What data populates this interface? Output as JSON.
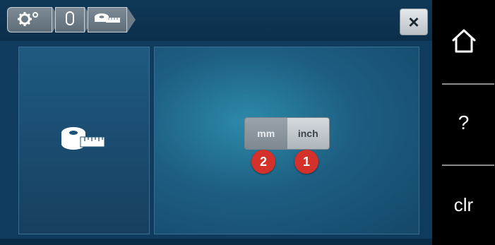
{
  "breadcrumb": {
    "items": [
      {
        "icon": "settings-gears-icon"
      },
      {
        "icon": "presser-foot-icon"
      },
      {
        "icon": "measuring-tape-icon"
      }
    ]
  },
  "close_label": "×",
  "units": {
    "mm_label": "mm",
    "inch_label": "inch",
    "selected": "inch"
  },
  "badges": {
    "mm": "2",
    "inch": "1"
  },
  "sidebar": {
    "home_icon": "home-icon",
    "help_label": "?",
    "clear_label": "clr"
  }
}
